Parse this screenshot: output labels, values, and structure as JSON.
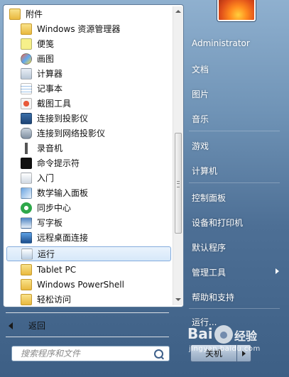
{
  "programs": [
    {
      "label": "附件",
      "icon": "folder-icon",
      "top": true
    },
    {
      "label": "Windows 资源管理器",
      "icon": "explorer-icon"
    },
    {
      "label": "便笺",
      "icon": "sticky-notes-icon"
    },
    {
      "label": "画图",
      "icon": "paint-icon"
    },
    {
      "label": "计算器",
      "icon": "calculator-icon"
    },
    {
      "label": "记事本",
      "icon": "notepad-icon"
    },
    {
      "label": "截图工具",
      "icon": "snipping-tool-icon"
    },
    {
      "label": "连接到投影仪",
      "icon": "projector-icon"
    },
    {
      "label": "连接到网络投影仪",
      "icon": "network-projector-icon"
    },
    {
      "label": "录音机",
      "icon": "microphone-icon"
    },
    {
      "label": "命令提示符",
      "icon": "command-prompt-icon"
    },
    {
      "label": "入门",
      "icon": "getting-started-icon"
    },
    {
      "label": "数学输入面板",
      "icon": "math-input-icon"
    },
    {
      "label": "同步中心",
      "icon": "sync-center-icon"
    },
    {
      "label": "写字板",
      "icon": "wordpad-icon"
    },
    {
      "label": "远程桌面连接",
      "icon": "remote-desktop-icon"
    },
    {
      "label": "运行",
      "icon": "run-icon",
      "selected": true
    },
    {
      "label": "Tablet PC",
      "icon": "folder-icon"
    },
    {
      "label": "Windows PowerShell",
      "icon": "folder-icon"
    },
    {
      "label": "轻松访问",
      "icon": "folder-icon"
    }
  ],
  "back_label": "返回",
  "search": {
    "placeholder": "搜索程序和文件"
  },
  "user": {
    "name": "Administrator"
  },
  "right_menu": [
    {
      "label": "文档"
    },
    {
      "label": "图片"
    },
    {
      "label": "音乐"
    },
    {
      "label": "游戏"
    },
    {
      "label": "计算机"
    },
    {
      "label": "控制面板"
    },
    {
      "label": "设备和打印机"
    },
    {
      "label": "默认程序"
    },
    {
      "label": "管理工具",
      "has_submenu": true
    },
    {
      "label": "帮助和支持"
    },
    {
      "label": "运行..."
    }
  ],
  "shutdown_label": "关机",
  "watermark": {
    "logo": "Bai",
    "brand": "经验",
    "url": "jingyan.baidu.com"
  }
}
